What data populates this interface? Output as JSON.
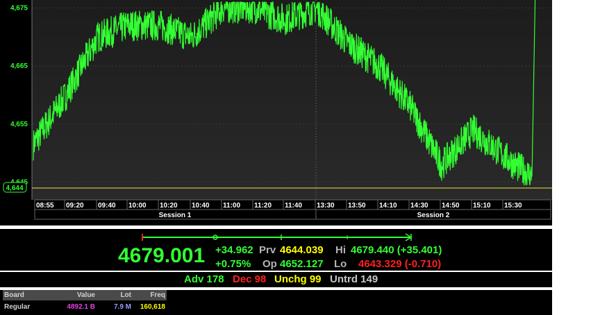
{
  "chart": {
    "y_ticks": [
      "4,675",
      "4,665",
      "4,655",
      "4,645"
    ],
    "last_marker": "4,644",
    "x_ticks": [
      "08:55",
      "09:20",
      "09:40",
      "10:00",
      "10:20",
      "10:40",
      "11:00",
      "11:20",
      "11:40",
      "13:30",
      "13:50",
      "14:10",
      "14:30",
      "14:50",
      "15:10",
      "15:30"
    ],
    "sessions": [
      "Session 1",
      "Session 2"
    ],
    "line_color": "#33ff33",
    "prev_close_line_color": "#e6e64d"
  },
  "chart_data": {
    "type": "line",
    "title": "",
    "xlabel": "",
    "ylabel": "",
    "ylim": [
      4644,
      4676
    ],
    "x": [
      "08:55",
      "09:20",
      "09:40",
      "10:00",
      "10:20",
      "10:40",
      "11:00",
      "11:20",
      "11:40",
      "13:30",
      "13:50",
      "14:10",
      "14:30",
      "14:50",
      "15:10",
      "15:30",
      "15:40"
    ],
    "series": [
      {
        "values": [
          4651.5,
          4660,
          4670,
          4672,
          4672,
          4670,
          4675,
          4675,
          4673,
          4675,
          4669,
          4665,
          4658,
          4648,
          4654,
          4648,
          4679
        ]
      }
    ],
    "reference_line": 4644.039
  },
  "quote": {
    "last": "4679.001",
    "change": "+34.962",
    "change_pct": "+0.75%",
    "prv_label": "Prv",
    "prv_value": "4644.039",
    "op_label": "Op",
    "op_value": "4652.127",
    "hi_label": "Hi",
    "hi_value": "4679.440 (+35.401)",
    "lo_label": "Lo",
    "lo_value": "4643.329 (-0.710)"
  },
  "breadth": {
    "adv": "Adv 178",
    "dec": "Dec 98",
    "unchg": "Unchg 99",
    "untrd": "Untrd 149"
  },
  "board": {
    "headers": {
      "board": "Board",
      "value": "Value",
      "lot": "Lot",
      "freq": "Freq"
    },
    "row": {
      "board": "Regular",
      "value": "4892.1 B",
      "lot": "7.9 M",
      "freq": "160,618"
    },
    "value_color": "#e040e0",
    "lot_color": "#9a9aff",
    "freq_color": "#ffff00"
  }
}
